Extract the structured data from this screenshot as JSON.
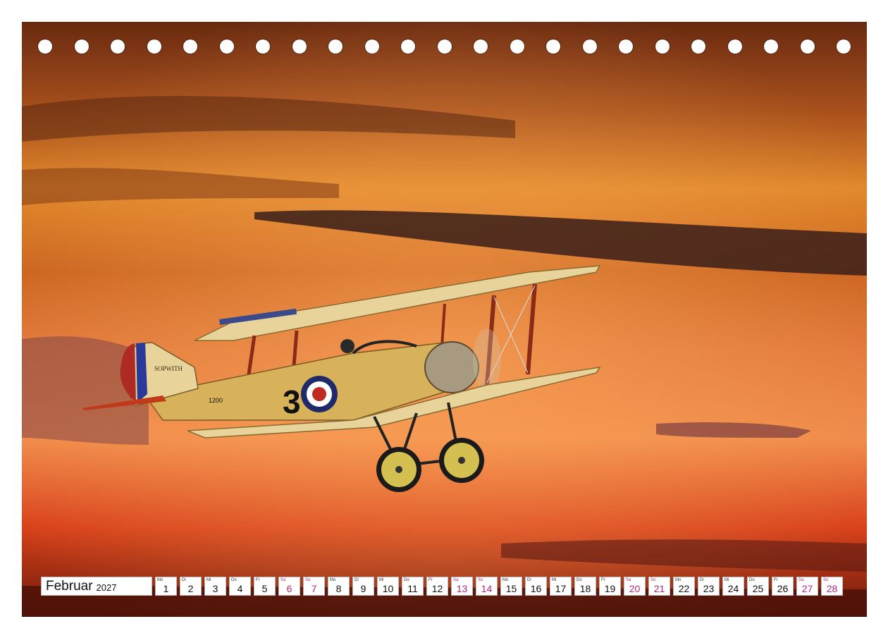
{
  "calendar": {
    "month": "Februar",
    "year": "2027",
    "days": [
      {
        "wd": "Mo",
        "n": "1",
        "we": false
      },
      {
        "wd": "Di",
        "n": "2",
        "we": false
      },
      {
        "wd": "Mi",
        "n": "3",
        "we": false
      },
      {
        "wd": "Do",
        "n": "4",
        "we": false
      },
      {
        "wd": "Fr",
        "n": "5",
        "we": false
      },
      {
        "wd": "Sa",
        "n": "6",
        "we": true
      },
      {
        "wd": "So",
        "n": "7",
        "we": true
      },
      {
        "wd": "Mo",
        "n": "8",
        "we": false
      },
      {
        "wd": "Di",
        "n": "9",
        "we": false
      },
      {
        "wd": "Mi",
        "n": "10",
        "we": false
      },
      {
        "wd": "Do",
        "n": "11",
        "we": false
      },
      {
        "wd": "Fr",
        "n": "12",
        "we": false
      },
      {
        "wd": "Sa",
        "n": "13",
        "we": true
      },
      {
        "wd": "So",
        "n": "14",
        "we": true
      },
      {
        "wd": "Mo",
        "n": "15",
        "we": false
      },
      {
        "wd": "Di",
        "n": "16",
        "we": false
      },
      {
        "wd": "Mi",
        "n": "17",
        "we": false
      },
      {
        "wd": "Do",
        "n": "18",
        "we": false
      },
      {
        "wd": "Fr",
        "n": "19",
        "we": false
      },
      {
        "wd": "Sa",
        "n": "20",
        "we": true
      },
      {
        "wd": "So",
        "n": "21",
        "we": true
      },
      {
        "wd": "Mo",
        "n": "22",
        "we": false
      },
      {
        "wd": "Di",
        "n": "23",
        "we": false
      },
      {
        "wd": "Mi",
        "n": "24",
        "we": false
      },
      {
        "wd": "Do",
        "n": "25",
        "we": false
      },
      {
        "wd": "Fr",
        "n": "26",
        "we": false
      },
      {
        "wd": "Sa",
        "n": "27",
        "we": true
      },
      {
        "wd": "So",
        "n": "28",
        "we": true
      }
    ]
  },
  "photo": {
    "tail_text": "SOPWITH",
    "fuselage_number": "3",
    "serial": "1200"
  },
  "colors": {
    "weekend": "#b0287a",
    "sky_top": "#5a2410",
    "sky_mid": "#e8761e",
    "sky_low": "#d33a12",
    "plane_body": "#d8b25a"
  }
}
